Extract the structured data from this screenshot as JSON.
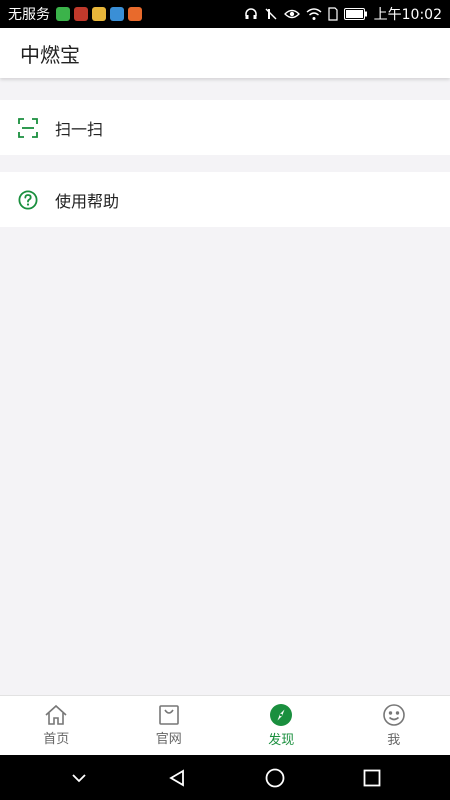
{
  "status_bar": {
    "carrier": "无服务",
    "time": "上午10:02"
  },
  "header": {
    "title": "中燃宝"
  },
  "menu": {
    "scan_label": "扫一扫",
    "help_label": "使用帮助"
  },
  "tabs": [
    {
      "label": "首页",
      "icon": "home-icon"
    },
    {
      "label": "官网",
      "icon": "shopping-bag-icon"
    },
    {
      "label": "发现",
      "icon": "compass-icon",
      "active": true
    },
    {
      "label": "我",
      "icon": "smiley-icon"
    }
  ],
  "colors": {
    "accent": "#1a8f3e",
    "background": "#f4f3f6"
  }
}
